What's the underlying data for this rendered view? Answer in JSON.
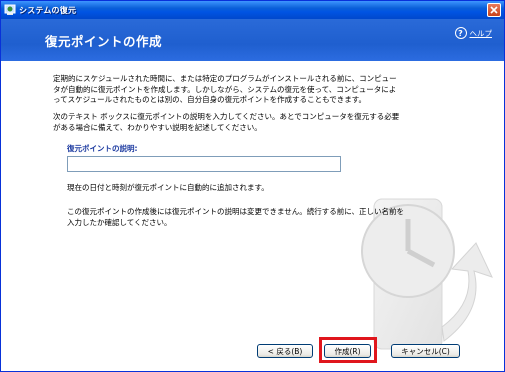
{
  "window": {
    "title": "システムの復元"
  },
  "header": {
    "title": "復元ポイントの作成",
    "help_label": "ヘルプ"
  },
  "content": {
    "paragraph1": "定期的にスケジュールされた時間に、または特定のプログラムがインストールされる前に、コンピュータが自動的に復元ポイントを作成します。しかしながら、システムの復元を使って、コンピュータによってスケジュールされたものとは別の、自分自身の復元ポイントを作成することもできます。",
    "paragraph2": "次のテキスト ボックスに復元ポイントの説明を入力してください。あとでコンピュータを復元する必要がある場合に備えて、わかりやすい説明を記述してください。",
    "field_label": "復元ポイントの説明:",
    "field_value": "",
    "paragraph3": "現在の日付と時刻が復元ポイントに自動的に追加されます。",
    "paragraph4": "この復元ポイントの作成後には復元ポイントの説明は変更できません。続行する前に、正しい名前を入力したか確認してください。"
  },
  "buttons": {
    "back": "< 戻る(B)",
    "create": "作成(R)",
    "cancel": "キャンセル(C)"
  },
  "colors": {
    "title_bar": "#0054e3",
    "header": "#2a6ad8",
    "highlight": "#e0161c",
    "field_label": "#1c3aa0"
  }
}
